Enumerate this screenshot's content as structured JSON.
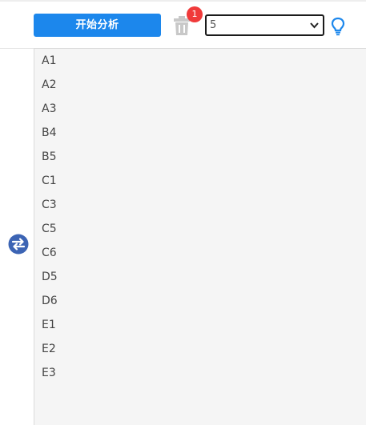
{
  "toolbar": {
    "analyze_button_label": "开始分析",
    "delete_badge_count": "1",
    "select_value": "5"
  },
  "colors": {
    "primary": "#1c87ec",
    "badge": "#f03a3a",
    "trash_disabled": "#c8c8c8",
    "swap_icon": "#3c64b4",
    "list_background": "#f5f5f5"
  },
  "icons": {
    "delete": "trash-icon",
    "select_arrow": "chevron-down-icon",
    "hint": "lightbulb-icon",
    "swap": "swap-arrows-icon"
  },
  "list": {
    "items": [
      "A1",
      "A2",
      "A3",
      "B4",
      "B5",
      "C1",
      "C3",
      "C5",
      "C6",
      "D5",
      "D6",
      "E1",
      "E2",
      "E3"
    ]
  }
}
